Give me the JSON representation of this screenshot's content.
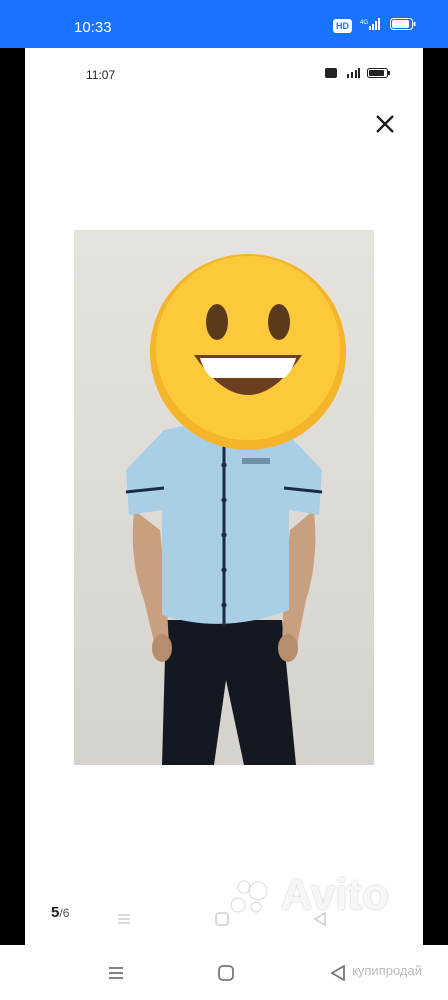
{
  "outer_status": {
    "time": "10:33",
    "hd": "HD",
    "signal": "4G"
  },
  "inner_status": {
    "time": "11:07"
  },
  "viewer": {
    "counter_current": "5",
    "counter_separator": "/",
    "counter_total": "6"
  },
  "watermark": {
    "brand": "Avito",
    "site": "купипродай"
  },
  "icons": {
    "close": "close-icon",
    "menu": "menu-icon",
    "home": "home-icon",
    "back": "back-icon"
  }
}
